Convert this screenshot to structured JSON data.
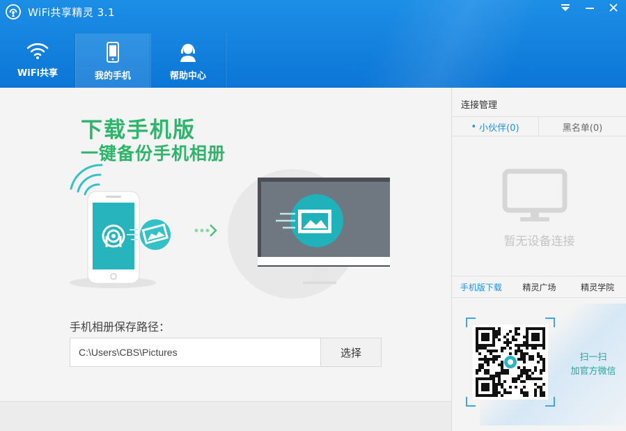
{
  "window": {
    "title": "WiFi共享精灵 3.1",
    "logo_icon": "wifi-broadcast-icon",
    "menu_icon": "dropdown-menu-icon",
    "minimize_icon": "minimize-icon",
    "close_icon": "close-icon"
  },
  "nav": {
    "items": [
      {
        "label": "WiFi共享",
        "icon": "wifi-icon"
      },
      {
        "label": "我的手机",
        "icon": "phone-icon"
      },
      {
        "label": "帮助中心",
        "icon": "support-agent-icon"
      }
    ],
    "active_index": 1
  },
  "main": {
    "promo_title": "下载手机版",
    "promo_subtitle": "一键备份手机相册",
    "path_label": "手机相册保存路径：",
    "path_value": "C:\\Users\\CBS\\Pictures",
    "select_button": "选择"
  },
  "side": {
    "header": "连接管理",
    "tabs": [
      {
        "label": "小伙伴(0)"
      },
      {
        "label": "黑名单(0)"
      }
    ],
    "active_tab": 0,
    "empty_text": "暂无设备连接",
    "empty_icon": "monitor-icon",
    "links": [
      {
        "label": "手机版下载"
      },
      {
        "label": "精灵广场"
      },
      {
        "label": "精灵学院"
      }
    ],
    "active_link": 0,
    "qr_line1": "扫一扫",
    "qr_line2": "加官方微信"
  },
  "colors": {
    "header_blue": "#0c76d6",
    "accent_green": "#2db56a",
    "teal": "#25a5a0",
    "link_blue": "#1f8fe0"
  }
}
